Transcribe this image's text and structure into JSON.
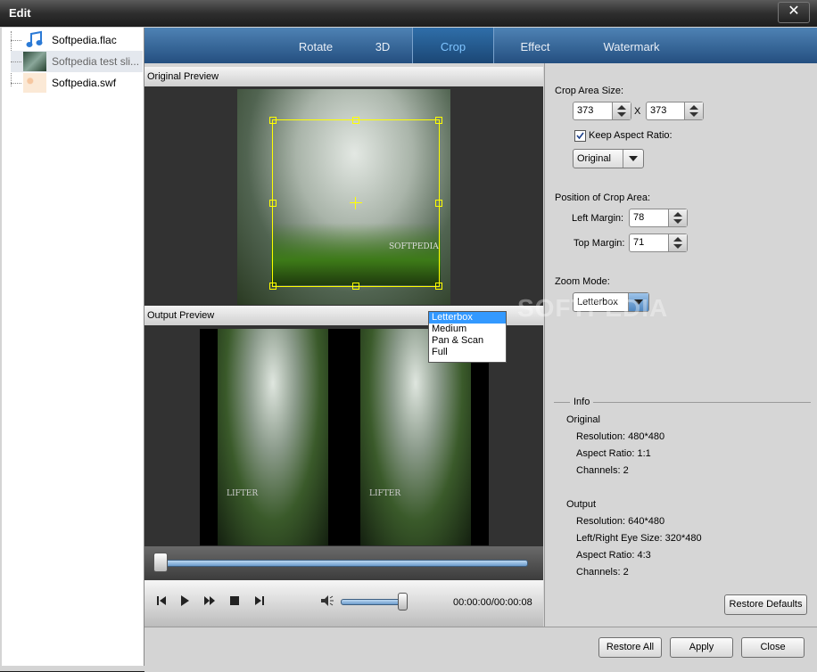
{
  "window": {
    "title": "Edit",
    "close_glyph": "✕"
  },
  "files": [
    {
      "name": "Softpedia.flac",
      "icon": "music-note-icon"
    },
    {
      "name": "Softpedia test sli...",
      "icon": "video-thumbnail-icon"
    },
    {
      "name": "Softpedia.swf",
      "icon": "flash-thumbnail-icon"
    }
  ],
  "tabs": [
    {
      "label": "Rotate",
      "active": false
    },
    {
      "label": "3D",
      "active": false
    },
    {
      "label": "Crop",
      "active": true
    },
    {
      "label": "Effect",
      "active": false
    },
    {
      "label": "Watermark",
      "active": false
    }
  ],
  "preview": {
    "original_label": "Original Preview",
    "output_label": "Output Preview",
    "original_overlay_text": "SOFTPEDIA",
    "output_overlay_text": "LIFTER"
  },
  "crop": {
    "area_size_label": "Crop Area Size:",
    "width": "373",
    "height": "373",
    "x_sep": "X",
    "keep_aspect_label": "Keep Aspect Ratio:",
    "keep_aspect_checked": true,
    "aspect_value": "Original",
    "position_label": "Position of Crop Area:",
    "left_margin_label": "Left Margin:",
    "left_margin": "78",
    "top_margin_label": "Top Margin:",
    "top_margin": "71",
    "zoom_label": "Zoom Mode:",
    "zoom_value": "Letterbox",
    "zoom_options": [
      "Letterbox",
      "Medium",
      "Pan & Scan",
      "Full"
    ]
  },
  "info": {
    "title": "Info",
    "original_title": "Original",
    "original_resolution": "Resolution: 480*480",
    "original_aspect": "Aspect Ratio: 1:1",
    "original_channels": "Channels: 2",
    "output_title": "Output",
    "output_resolution": "Resolution: 640*480",
    "output_eye_size": "Left/Right Eye Size: 320*480",
    "output_aspect": "Aspect Ratio: 4:3",
    "output_channels": "Channels: 2"
  },
  "playback": {
    "time": "00:00:00/00:00:08",
    "seek_progress": 0.0,
    "volume_level": 1.0
  },
  "buttons": {
    "restore_defaults": "Restore Defaults",
    "restore_all": "Restore All",
    "apply": "Apply",
    "close": "Close"
  },
  "watermark_text": "SOFTPEDIA",
  "colors": {
    "tab_active_text": "#7fc4ff",
    "crop_box": "#ffff00",
    "list_highlight": "#3399ff"
  }
}
